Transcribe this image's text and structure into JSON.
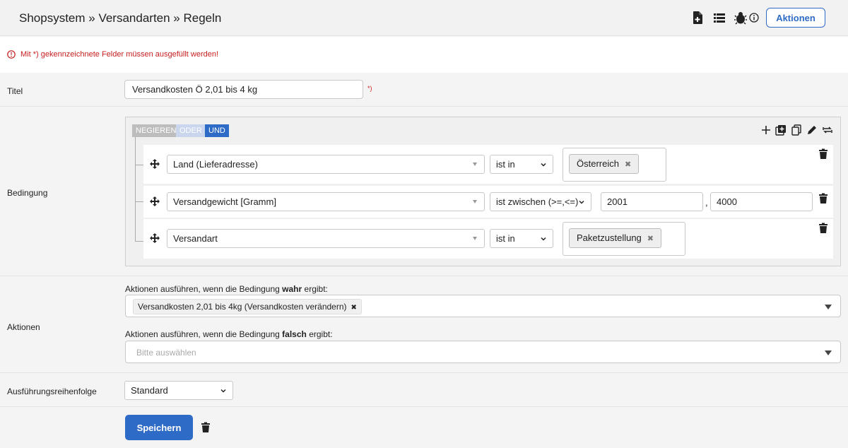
{
  "header": {
    "title": "Shopsystem » Versandarten » Regeln",
    "icons": [
      "file-plus-icon",
      "list-icon",
      "bug-icon",
      "info-icon"
    ],
    "actions_label": "Aktionen"
  },
  "notice": {
    "text": "Mit *) gekennzeichnete Felder müssen ausgefüllt werden!"
  },
  "title_row": {
    "label": "Titel",
    "value": "Versandkosten Ö 2,01 bis 4 kg",
    "required_mark": "*)"
  },
  "condition": {
    "label": "Bedingung",
    "group_buttons": {
      "negate": "NEGIEREN",
      "or": "ODER",
      "and": "UND",
      "active": "and"
    },
    "toolbar_icons": [
      "plus-icon",
      "add-group-icon",
      "copy-icon",
      "edit-icon",
      "swap-icon"
    ],
    "rules": [
      {
        "field": "Land (Lieferadresse)",
        "operator": "ist in",
        "tags": [
          "Österreich"
        ]
      },
      {
        "field": "Versandgewicht [Gramm]",
        "operator": "ist zwischen (>=,<=)",
        "value_from": "2001",
        "separator": ",",
        "value_to": "4000"
      },
      {
        "field": "Versandart",
        "operator": "ist in",
        "tags": [
          "Paketzustellung"
        ]
      }
    ]
  },
  "actions": {
    "label": "Aktionen",
    "true_text_before": "Aktionen ausführen, wenn die Bedingung ",
    "true_bold": "wahr",
    "true_text_after": " ergibt:",
    "true_selected": "Versandkosten 2,01 bis 4kg (Versandkosten verändern)",
    "false_text_before": "Aktionen ausführen, wenn die Bedingung ",
    "false_bold": "falsch",
    "false_text_after": " ergibt:",
    "false_placeholder": "Bitte auswählen"
  },
  "order": {
    "label": "Ausführungsreihenfolge",
    "value": "Standard"
  },
  "footer": {
    "save_label": "Speichern"
  },
  "colors": {
    "primary": "#2e6bc7",
    "error": "#c81e1e",
    "and_active": "#2e6bc7",
    "or_inactive": "#c9d6ee",
    "negate_inactive": "#bdbdbd"
  }
}
